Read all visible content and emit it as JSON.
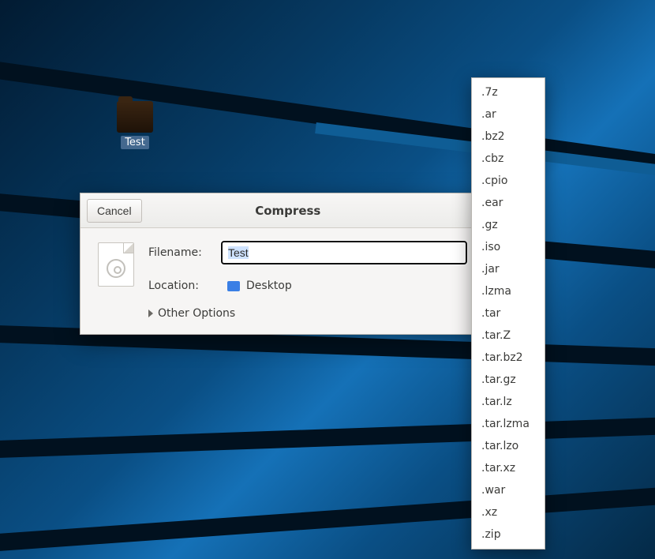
{
  "desktop": {
    "icon_label": "Test"
  },
  "dialog": {
    "title": "Compress",
    "cancel_label": "Cancel",
    "filename_label": "Filename:",
    "filename_value": "Test",
    "location_label": "Location:",
    "location_value": "Desktop",
    "other_options_label": "Other Options"
  },
  "extensions": [
    ".7z",
    ".ar",
    ".bz2",
    ".cbz",
    ".cpio",
    ".ear",
    ".gz",
    ".iso",
    ".jar",
    ".lzma",
    ".tar",
    ".tar.Z",
    ".tar.bz2",
    ".tar.gz",
    ".tar.lz",
    ".tar.lzma",
    ".tar.lzo",
    ".tar.xz",
    ".war",
    ".xz",
    ".zip"
  ]
}
